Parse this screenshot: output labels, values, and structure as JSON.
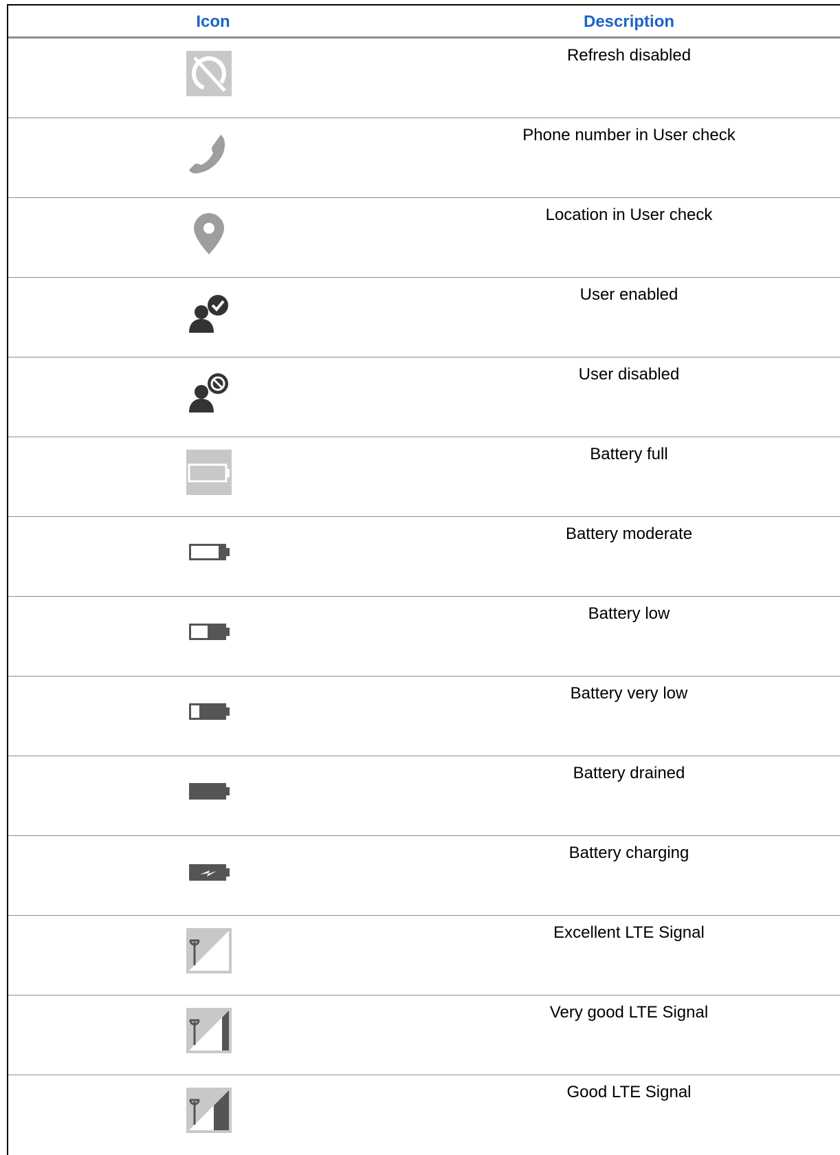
{
  "header": {
    "icon_label": "Icon",
    "description_label": "Description"
  },
  "rows": [
    {
      "icon": "refresh-disabled-icon",
      "description": "Refresh disabled"
    },
    {
      "icon": "phone-icon",
      "description": "Phone number in User check"
    },
    {
      "icon": "location-pin-icon",
      "description": "Location in User check"
    },
    {
      "icon": "user-enabled-icon",
      "description": "User enabled"
    },
    {
      "icon": "user-disabled-icon",
      "description": "User disabled"
    },
    {
      "icon": "battery-full-icon",
      "description": "Battery full"
    },
    {
      "icon": "battery-moderate-icon",
      "description": "Battery moderate"
    },
    {
      "icon": "battery-low-icon",
      "description": "Battery low"
    },
    {
      "icon": "battery-very-low-icon",
      "description": "Battery very low"
    },
    {
      "icon": "battery-drained-icon",
      "description": "Battery drained"
    },
    {
      "icon": "battery-charging-icon",
      "description": "Battery charging"
    },
    {
      "icon": "lte-signal-excellent-icon",
      "description": "Excellent LTE Signal"
    },
    {
      "icon": "lte-signal-very-good-icon",
      "description": "Very good LTE Signal"
    },
    {
      "icon": "lte-signal-good-icon",
      "description": "Good LTE Signal"
    }
  ],
  "colors": {
    "header_text": "#1a64c8",
    "icon_gray": "#9e9e9e",
    "icon_dark": "#333333",
    "icon_tile": "#c8c8c8"
  }
}
